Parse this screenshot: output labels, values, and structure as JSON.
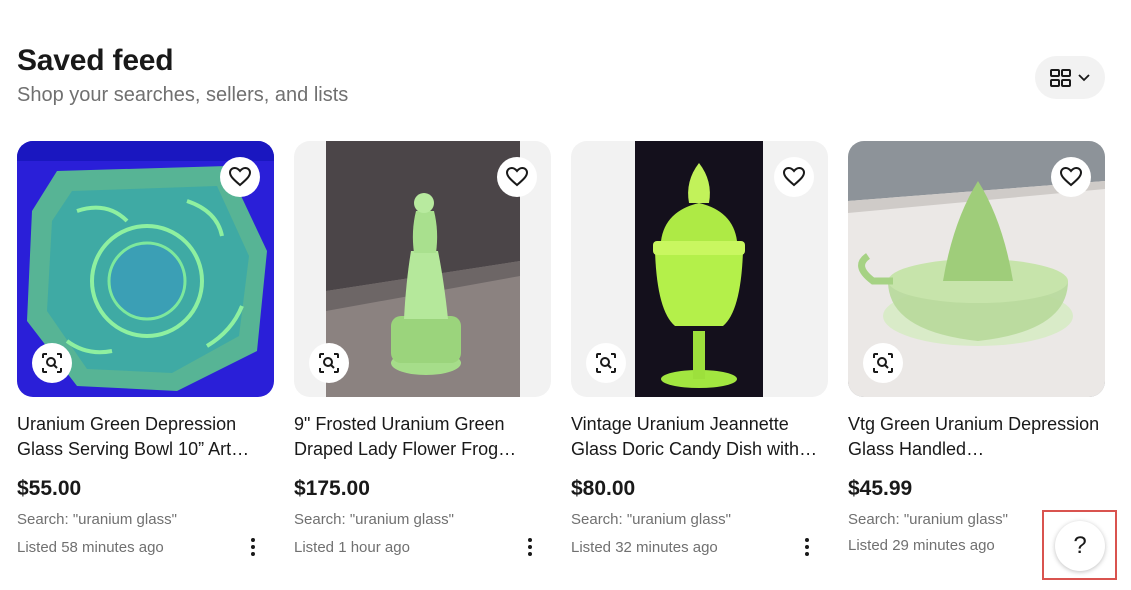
{
  "header": {
    "title": "Saved feed",
    "subtitle": "Shop your searches, sellers, and lists"
  },
  "view_toggle": {
    "icon": "grid-view-icon",
    "chevron": "chevron-down-icon"
  },
  "items": [
    {
      "title": "Uranium Green Depression Glass Serving Bowl 10” Art…",
      "price": "$55.00",
      "search": "Search: \"uranium glass\"",
      "listed": "Listed 58 minutes ago"
    },
    {
      "title": "9\" Frosted Uranium Green Draped Lady Flower Frog…",
      "price": "$175.00",
      "search": "Search: \"uranium glass\"",
      "listed": "Listed 1 hour ago"
    },
    {
      "title": "Vintage Uranium Jeannette Glass Doric Candy Dish with…",
      "price": "$80.00",
      "search": "Search: \"uranium glass\"",
      "listed": "Listed 32 minutes ago"
    },
    {
      "title": "Vtg Green Uranium Depression Glass Handled…",
      "price": "$45.99",
      "search": "Search: \"uranium glass\"",
      "listed": "Listed 29 minutes ago"
    }
  ],
  "help": {
    "label": "?"
  },
  "colors": {
    "text": "#191919",
    "muted": "#707070",
    "chip_bg": "#f2f2f2",
    "highlight": "#d9534f"
  }
}
